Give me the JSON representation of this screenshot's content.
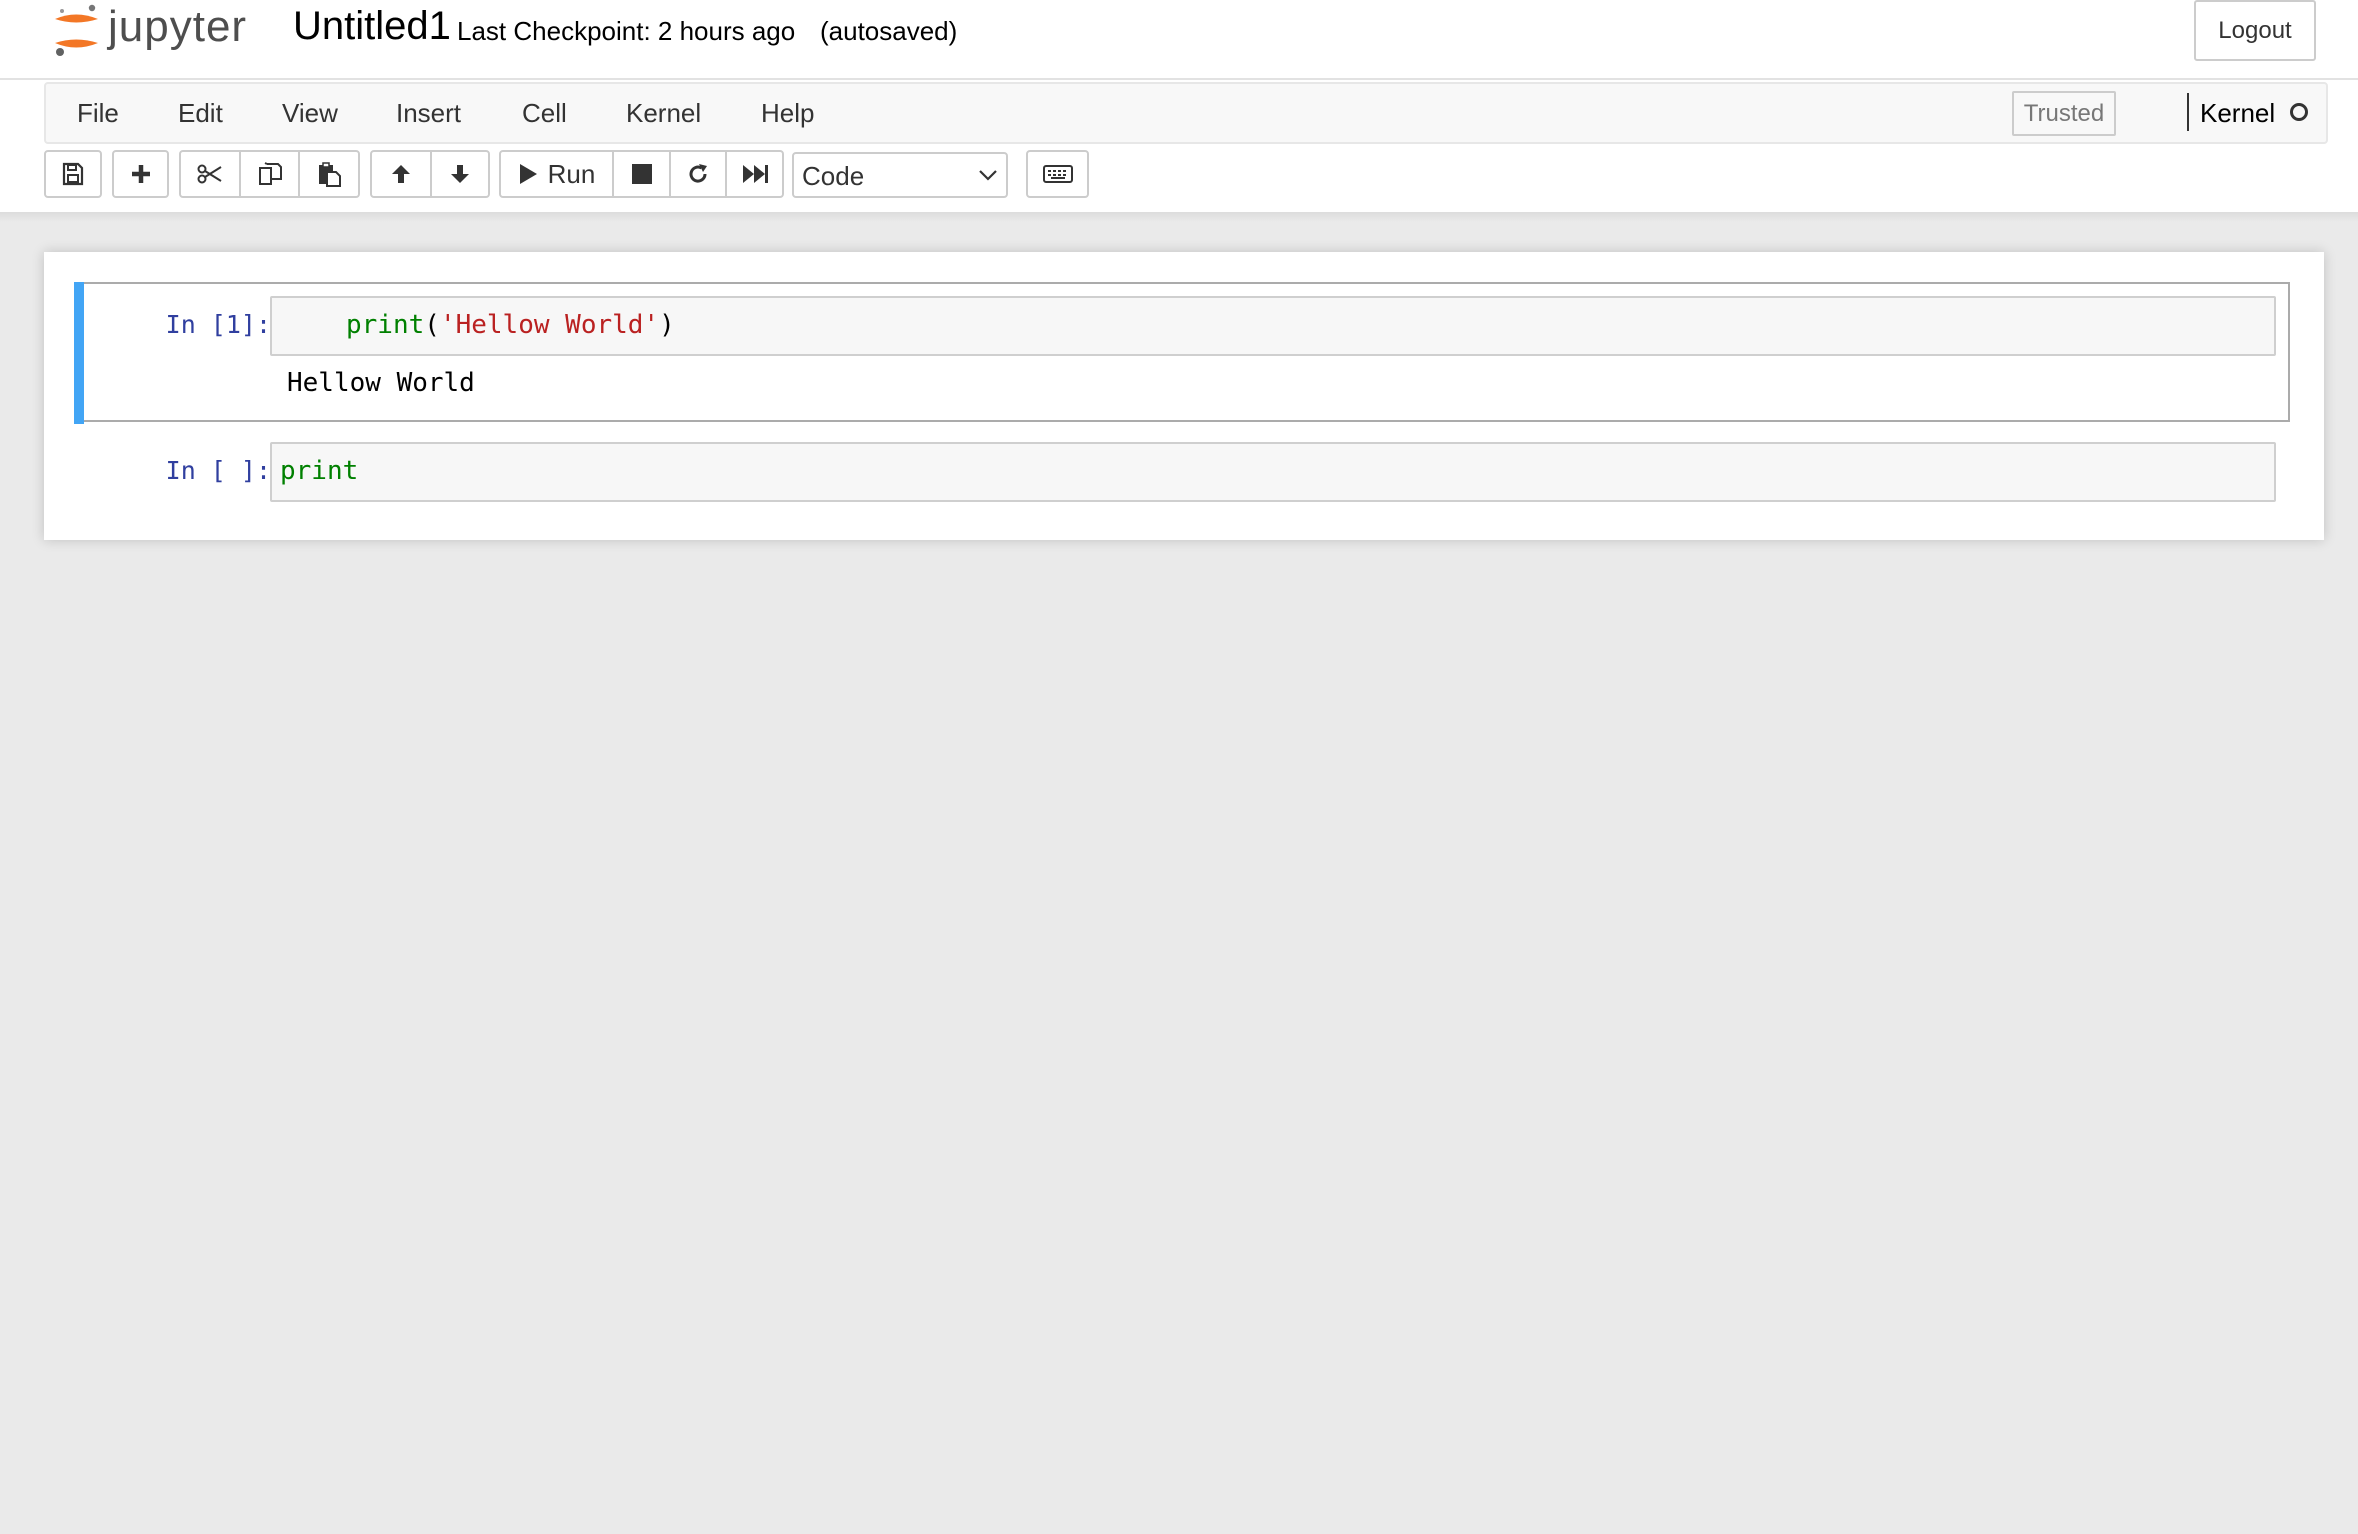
{
  "header": {
    "logo_text": "jupyter",
    "notebook_name": "Untitled1",
    "checkpoint": "Last Checkpoint: 2 hours ago",
    "autosave": "(autosaved)",
    "logout_label": "Logout"
  },
  "menubar": {
    "items": [
      "File",
      "Edit",
      "View",
      "Insert",
      "Cell",
      "Kernel",
      "Help"
    ],
    "trusted_label": "Trusted",
    "kernel_name": "Kernel",
    "kernel_status": "idle"
  },
  "toolbar": {
    "buttons": [
      "save-icon",
      "plus-icon",
      "scissors-icon",
      "copy-icon",
      "paste-icon",
      "arrow-up-icon",
      "arrow-down-icon",
      "run-icon",
      "stop-icon",
      "restart-icon",
      "fast-forward-icon",
      "keyboard-icon"
    ],
    "run_label": "Run",
    "cell_type": "Code"
  },
  "cells": [
    {
      "prompt": "In [1]:",
      "code_func": "print",
      "code_open": "(",
      "code_str": "'Hellow World'",
      "code_close": ")",
      "output": "Hellow World",
      "selected": true
    },
    {
      "prompt": "In [ ]:",
      "code_func": "print"
    }
  ],
  "colors": {
    "selection_bar": "#42a5f5",
    "prompt": "#303f9f",
    "builtin": "#008000",
    "string": "#ba2121",
    "logo_orange": "#f37726"
  }
}
